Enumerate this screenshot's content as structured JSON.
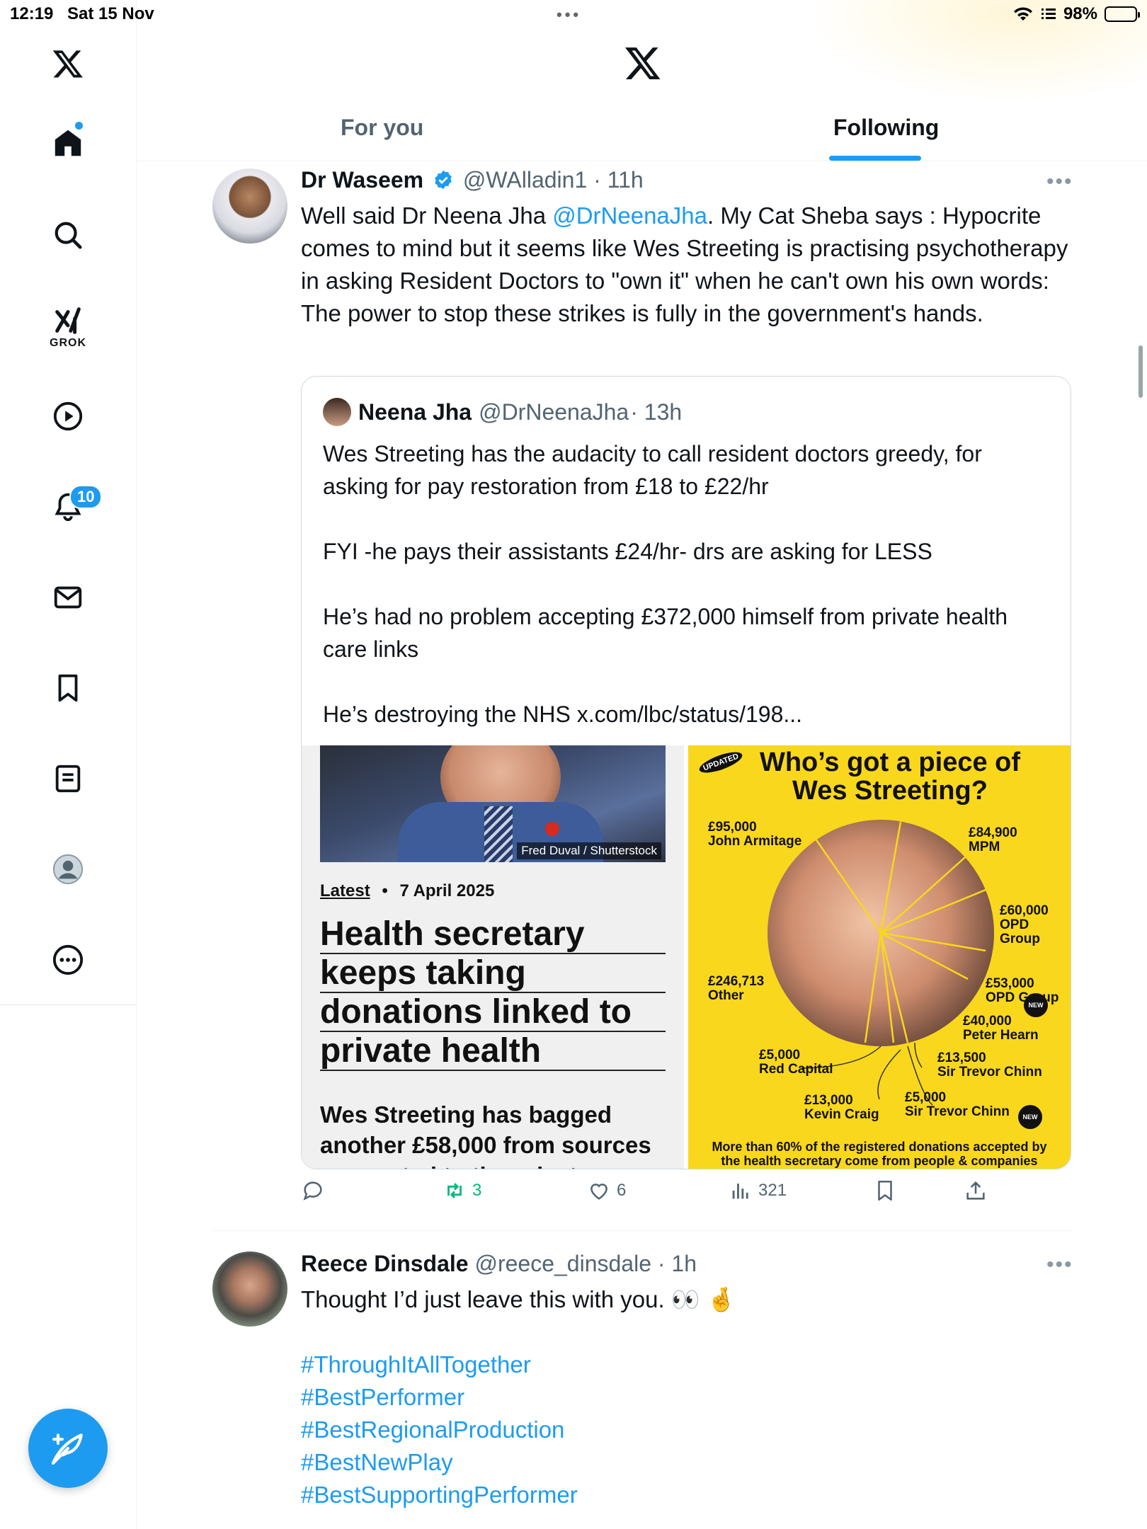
{
  "status_bar": {
    "time": "12:19",
    "date": "Sat 15 Nov",
    "battery": "98%"
  },
  "sidebar": {
    "grok_label": "GROK",
    "notifications_badge": "10",
    "items": [
      "home-icon",
      "search-icon",
      "grok-icon",
      "video-icon",
      "notifications-icon",
      "messages-icon",
      "bookmarks-icon",
      "lists-icon",
      "profile-icon",
      "more-icon"
    ]
  },
  "header": {
    "tabs": [
      {
        "label": "For you"
      },
      {
        "label": "Following"
      }
    ]
  },
  "tweet1": {
    "name": "Dr Waseem",
    "handle": "@WAlladin1",
    "time": "· 11h",
    "text_before": "Well said Dr Neena Jha ",
    "mention": "@DrNeenaJha",
    "text_after": ". My Cat Sheba says : Hypocrite comes to mind but it seems like Wes Streeting is practising psychotherapy in asking Resident Doctors to \"own it\" when he can't own his own words:  The power to stop these strikes is fully in the government's hands.",
    "quote": {
      "name": "Neena Jha",
      "handle": "@DrNeenaJha",
      "time": "· 13h",
      "paragraphs": [
        "Wes Streeting has the audacity to call resident doctors greedy, for asking for pay restoration from £18 to £22/hr",
        "FYI -he pays their assistants £24/hr- drs are asking for LESS",
        "He’s had no problem accepting £372,000 himself from private health care links",
        "He’s destroying the NHS x.com/lbc/status/198..."
      ],
      "left_card": {
        "credit": "Fred Duval / Shutterstock",
        "latest": "Latest",
        "date": "7 April 2025",
        "headline_lines": [
          "Health secretary",
          "keeps taking",
          "donations linked to",
          "private health"
        ],
        "sub": "Wes Streeting has bagged another £58,000 from sources connected to the private"
      },
      "right_card": {
        "stamp": "UPDATED",
        "title_line1": "Who’s got a piece of",
        "title_line2": "Wes Streeting?",
        "labels": [
          {
            "amount": "£95,000",
            "who": "John Armitage"
          },
          {
            "amount": "£84,900",
            "who": "MPM"
          },
          {
            "amount": "£60,000",
            "who": "OPD Group"
          },
          {
            "amount": "£53,000",
            "who": "OPD Group"
          },
          {
            "amount": "£246,713",
            "who": "Other"
          },
          {
            "amount": "£40,000",
            "who": "Peter Hearn"
          },
          {
            "amount": "£13,500",
            "who": "Sir Trevor Chinn"
          },
          {
            "amount": "£5,000",
            "who": "Red Capital"
          },
          {
            "amount": "£13,000",
            "who": "Kevin Craig"
          },
          {
            "amount": "£5,000",
            "who": "Sir Trevor Chinn"
          }
        ],
        "new_tag": "NEW",
        "footer": "More than 60% of the registered donations accepted by the health secretary come from people & companies linked to private health."
      }
    },
    "actions": {
      "retweets": "3",
      "likes": "6",
      "views": "321"
    }
  },
  "tweet2": {
    "name": "Reece Dinsdale",
    "handle": "@reece_dinsdale",
    "time": "· 1h",
    "text": "Thought I’d just leave this with you. 👀 🤞",
    "hashtags": [
      "#ThroughItAllTogether",
      "#BestPerformer",
      "#BestRegionalProduction",
      "#BestNewPlay",
      "#BestSupportingPerformer"
    ]
  },
  "colors": {
    "accent": "#1d9bf0",
    "retweet": "#00ba7c",
    "muted": "#536471",
    "infographic_bg": "#f9d71c"
  }
}
